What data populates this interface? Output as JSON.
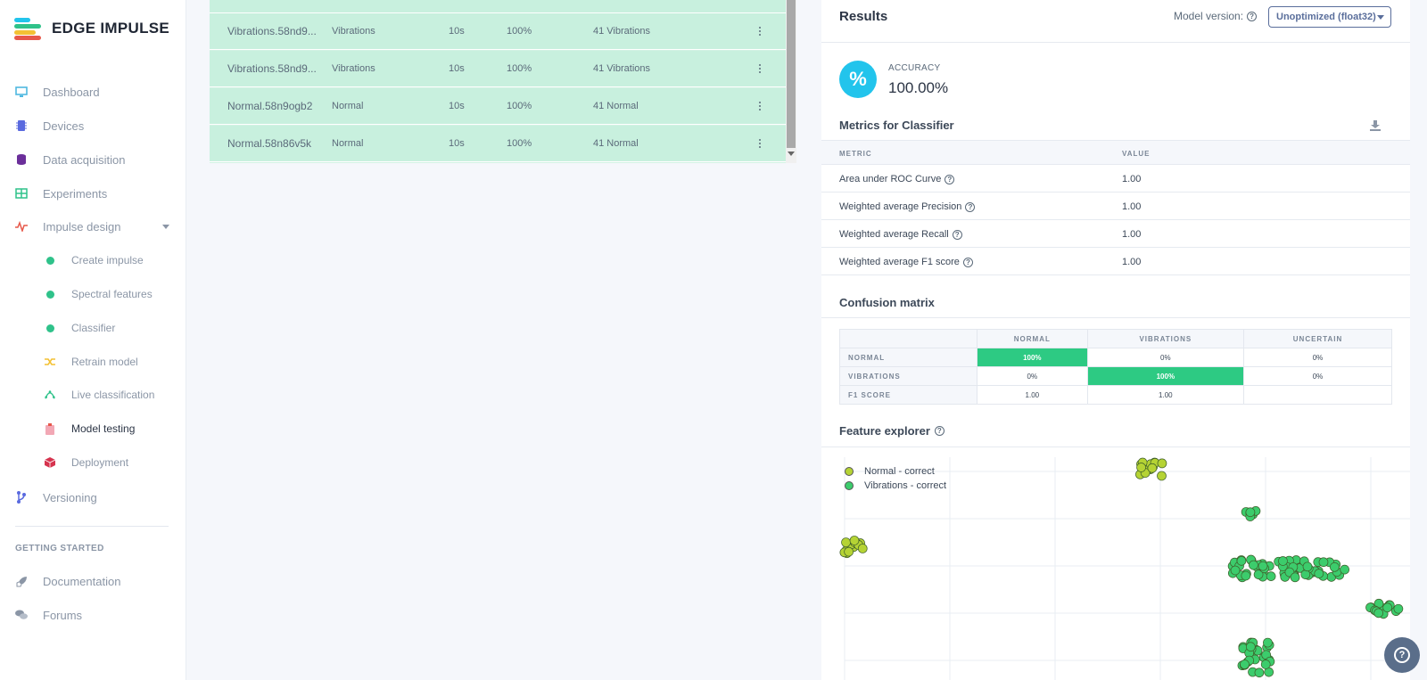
{
  "brand": {
    "name": "EDGE IMPULSE",
    "colors": [
      "#2fc28a",
      "#f3c134",
      "#22c4ec",
      "#e7584a"
    ]
  },
  "sidebar": {
    "items": [
      {
        "label": "Dashboard",
        "icon": "monitor-icon",
        "color": "#4fb8e0"
      },
      {
        "label": "Devices",
        "icon": "chip-icon",
        "color": "#5a6adf"
      },
      {
        "label": "Data acquisition",
        "icon": "database-icon",
        "color": "#6b2f9a"
      },
      {
        "label": "Experiments",
        "icon": "table-icon",
        "color": "#2fc28a"
      },
      {
        "label": "Impulse design",
        "icon": "pulse-icon",
        "color": "#e7584a"
      }
    ],
    "subitems": [
      {
        "label": "Create impulse",
        "icon": "dot-icon"
      },
      {
        "label": "Spectral features",
        "icon": "dot-icon"
      },
      {
        "label": "Classifier",
        "icon": "dot-icon"
      },
      {
        "label": "Retrain model",
        "icon": "shuffle-icon"
      },
      {
        "label": "Live classification",
        "icon": "live-icon"
      },
      {
        "label": "Model testing",
        "icon": "clipboard-icon"
      },
      {
        "label": "Deployment",
        "icon": "cube-icon"
      }
    ],
    "versioning": "Versioning",
    "getting_started": "GETTING STARTED",
    "documentation": "Documentation",
    "forums": "Forums"
  },
  "samples": [
    {
      "name": "Vibrations.58nd9...",
      "label": "Vibrations",
      "length": "10s",
      "accuracy": "100%",
      "result": "41 Vibrations"
    },
    {
      "name": "Vibrations.58nd9...",
      "label": "Vibrations",
      "length": "10s",
      "accuracy": "100%",
      "result": "41 Vibrations"
    },
    {
      "name": "Normal.58n9ogb2",
      "label": "Normal",
      "length": "10s",
      "accuracy": "100%",
      "result": "41 Normal"
    },
    {
      "name": "Normal.58n86v5k",
      "label": "Normal",
      "length": "10s",
      "accuracy": "100%",
      "result": "41 Normal"
    }
  ],
  "results": {
    "title": "Results",
    "model_version_label": "Model version:",
    "model_version_value": "Unoptimized (float32)",
    "accuracy_symbol": "%",
    "accuracy_label": "ACCURACY",
    "accuracy_value": "100.00%",
    "metrics_title": "Metrics for Classifier",
    "metrics_headers": {
      "metric": "METRIC",
      "value": "VALUE"
    },
    "metrics": [
      {
        "name": "Area under ROC Curve",
        "value": "1.00"
      },
      {
        "name": "Weighted average Precision",
        "value": "1.00"
      },
      {
        "name": "Weighted average Recall",
        "value": "1.00"
      },
      {
        "name": "Weighted average F1 score",
        "value": "1.00"
      }
    ],
    "confusion_title": "Confusion matrix",
    "confusion": {
      "columns": [
        "NORMAL",
        "VIBRATIONS",
        "UNCERTAIN"
      ],
      "rows": [
        {
          "label": "NORMAL",
          "cells": [
            "100%",
            "0%",
            "0%"
          ]
        },
        {
          "label": "VIBRATIONS",
          "cells": [
            "0%",
            "100%",
            "0%"
          ]
        },
        {
          "label": "F1 SCORE",
          "cells": [
            "1.00",
            "1.00",
            ""
          ]
        }
      ]
    },
    "feature_title": "Feature explorer"
  },
  "chart_data": {
    "type": "scatter",
    "series": [
      {
        "name": "Normal - correct",
        "color": "#b5d334",
        "points": [
          [
            0.55,
            0.95
          ],
          [
            0.02,
            0.6
          ]
        ]
      },
      {
        "name": "Vibrations - correct",
        "color": "#3ccc6c",
        "points": [
          [
            0.73,
            0.75
          ],
          [
            0.8,
            0.5
          ],
          [
            0.97,
            0.32
          ],
          [
            0.74,
            0.1
          ]
        ]
      }
    ],
    "grid": true,
    "legend": "top-left"
  }
}
